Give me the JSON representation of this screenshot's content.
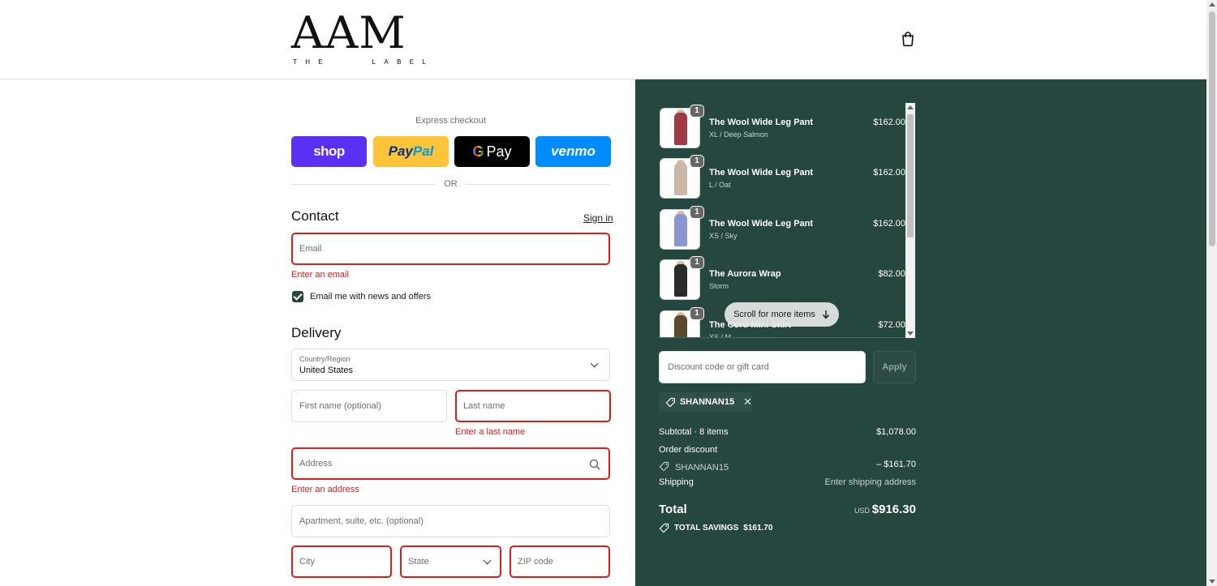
{
  "brand": {
    "logo_main": "AAM",
    "logo_sub": [
      "T",
      "H",
      "E",
      "L",
      "A",
      "B",
      "E",
      "L"
    ]
  },
  "express": {
    "label": "Express checkout",
    "shop_label": "shop",
    "paypal_a": "Pay",
    "paypal_b": "Pal",
    "gpay_g": "G",
    "gpay_label": "Pay",
    "venmo_label": "venmo",
    "or": "OR"
  },
  "contact": {
    "heading": "Contact",
    "sign_in": "Sign in",
    "email_placeholder": "Email",
    "email_error": "Enter an email",
    "news_label": "Email me with news and offers"
  },
  "delivery": {
    "heading": "Delivery",
    "country_label": "Country/Region",
    "country_value": "United States",
    "first_name_placeholder": "First name (optional)",
    "last_name_placeholder": "Last name",
    "last_name_error": "Enter a last name",
    "address_placeholder": "Address",
    "address_error": "Enter an address",
    "apartment_placeholder": "Apartment, suite, etc. (optional)",
    "city_placeholder": "City",
    "state_placeholder": "State",
    "zip_placeholder": "ZIP code"
  },
  "cart": {
    "items": [
      {
        "name": "The Wool Wide Leg Pant",
        "variant": "XL / Deep Salmon",
        "price": "$162.00",
        "qty": "1",
        "color": "#9e3a44"
      },
      {
        "name": "The Wool Wide Leg Pant",
        "variant": "L / Oat",
        "price": "$162.00",
        "qty": "1",
        "color": "#c9b8a8"
      },
      {
        "name": "The Wool Wide Leg Pant",
        "variant": "XS / Sky",
        "price": "$162.00",
        "qty": "1",
        "color": "#8a96cf"
      },
      {
        "name": "The Aurora Wrap",
        "variant": "Storm",
        "price": "$82.00",
        "qty": "1",
        "color": "#2b2b2b"
      },
      {
        "name": "The Cord Mini Skirt",
        "variant": "XS / M",
        "price": "$72.00",
        "qty": "1",
        "color": "#5a4a2c"
      }
    ],
    "scroll_hint": "Scroll for more items"
  },
  "discount": {
    "placeholder": "Discount code or gift card",
    "apply": "Apply",
    "code": "SHANNAN15"
  },
  "summary": {
    "subtotal_label": "Subtotal · 8 items",
    "subtotal_value": "$1,078.00",
    "order_discount_label": "Order discount",
    "discount_code": "SHANNAN15",
    "discount_value": "– $161.70",
    "shipping_label": "Shipping",
    "shipping_value": "Enter shipping address",
    "total_label": "Total",
    "currency": "USD",
    "total_value": "$916.30",
    "savings_label": "TOTAL SAVINGS",
    "savings_value": "$161.70"
  },
  "colors": {
    "summary_bg": "#264640",
    "error": "#dd1d1d",
    "shop": "#5a31f4",
    "paypal": "#ffc439",
    "venmo": "#008cff"
  }
}
